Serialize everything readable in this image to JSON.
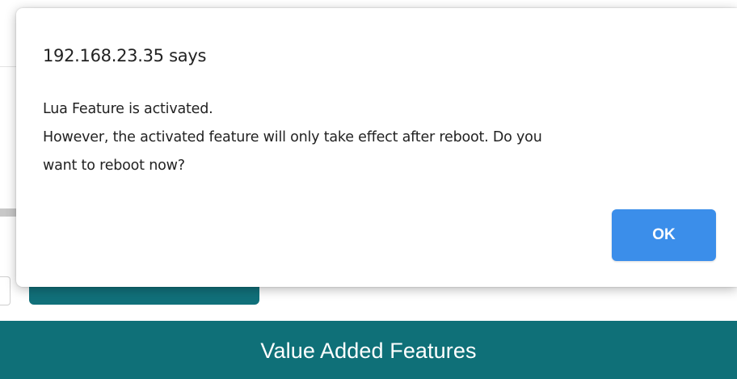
{
  "dialog": {
    "title": "192.168.23.35 says",
    "message_lines": [
      "Lua Feature is activated.",
      "However, the activated feature will only take effect after reboot. Do you",
      "want to reboot now?"
    ],
    "ok_label": "OK",
    "ok_color": "#3b8eea"
  },
  "page": {
    "banner_title": "Value Added Features",
    "banner_color": "#0f7078",
    "partial_glyph": "ı"
  }
}
